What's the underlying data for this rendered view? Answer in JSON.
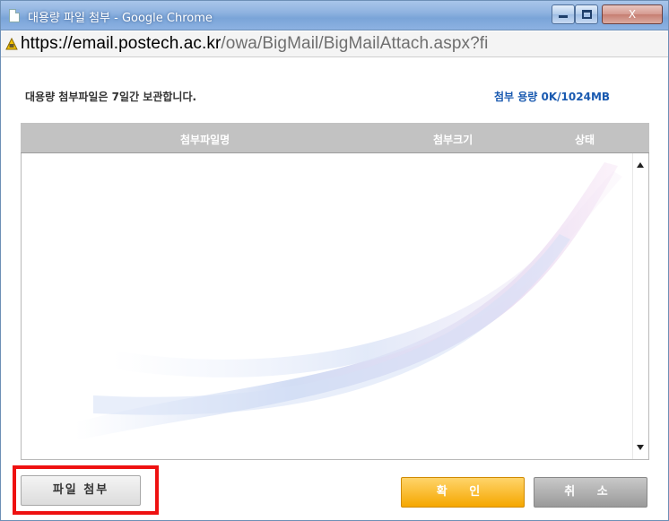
{
  "window": {
    "title": "대용량 파일 첨부 - Google Chrome",
    "close_label": "X"
  },
  "address": {
    "url_domain": "https://email.postech.ac.kr",
    "url_path": "/owa/BigMail/BigMailAttach.aspx?fi"
  },
  "info": {
    "retention_notice": "대용량 첨부파일은 7일간 보관합니다.",
    "capacity": "첨부 용량 0K/1024MB"
  },
  "table": {
    "headers": [
      "첨부파일명",
      "첨부크기",
      "상태"
    ],
    "rows": []
  },
  "buttons": {
    "attach_file": "파일 첨부",
    "confirm": "확 인",
    "cancel": "취 소"
  },
  "colors": {
    "highlight": "#ee1111",
    "confirm_button": "#f5a700",
    "capacity_text": "#1a5ab0"
  }
}
